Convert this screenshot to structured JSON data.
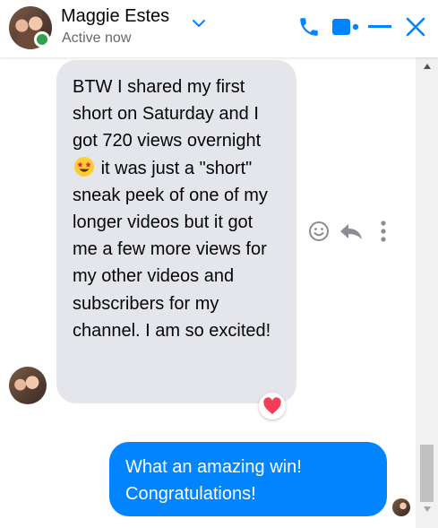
{
  "header": {
    "contact_name": "Maggie Estes",
    "status": "Active now",
    "presence_color": "#31a24c",
    "icons": [
      "chevron-down-icon",
      "phone-icon",
      "video-camera-icon",
      "minimize-icon",
      "close-icon"
    ],
    "accent_color": "#0084ff"
  },
  "thread": {
    "incoming": {
      "text_before_emoji": "BTW I shared my first short on Saturday and I got 720 views overnight",
      "emoji": "star-struck-emoji",
      "text_after_emoji": "it was just a \"short\" sneak peek of one of my longer videos but it got me a few more views for my other videos and subscribers for my channel. I am so excited!",
      "reaction": "heart-reaction",
      "bubble_color": "#e4e6eb"
    },
    "message_actions": [
      "react-icon",
      "reply-icon",
      "more-options-icon"
    ],
    "outgoing": {
      "text": "What an amazing win! Congratulations!",
      "bubble_color": "#0084ff"
    }
  }
}
